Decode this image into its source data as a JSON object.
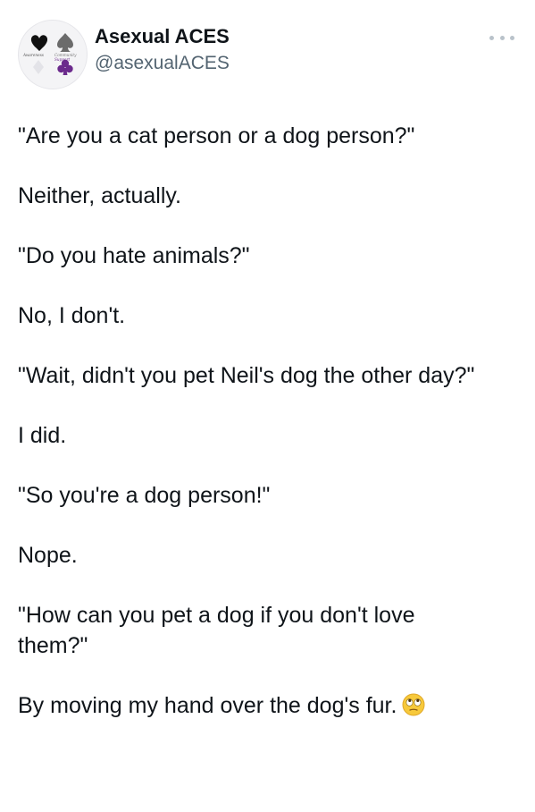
{
  "tweet": {
    "author": {
      "display_name": "Asexual ACES",
      "handle": "@asexualACES",
      "avatar_icon": "card-suits-logo-icon",
      "logo_text": [
        "Awareness",
        "Community",
        "Support"
      ]
    },
    "more_icon": "more-options-icon",
    "lines": [
      "\"Are you a cat person or a dog person?\"",
      "Neither, actually.",
      "\"Do you hate animals?\"",
      "No, I don't.",
      "\"Wait, didn't you pet Neil's dog the other day?\"",
      "I did.",
      "\"So you're a dog person!\"",
      "Nope.",
      "\"How can you pet a dog if you don't love them?\"",
      "By moving my hand over the dog's fur."
    ],
    "final_emoji": "face-with-rolling-eyes-icon",
    "colors": {
      "text": "#0f1419",
      "secondary_text": "#536471",
      "logo_purple": "#6b2a8c",
      "emoji_yellow": "#f7c93b"
    }
  }
}
